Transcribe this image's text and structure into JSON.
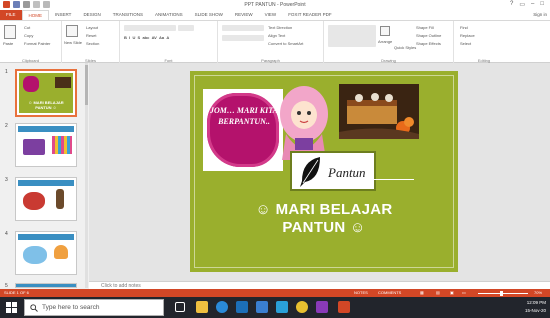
{
  "window": {
    "title": "PPT PANTUN - PowerPoint",
    "help": "?",
    "signin": "Sign in"
  },
  "tabs": [
    "FILE",
    "HOME",
    "INSERT",
    "DESIGN",
    "TRANSITIONS",
    "ANIMATIONS",
    "SLIDE SHOW",
    "REVIEW",
    "VIEW",
    "FOXIT READER PDF"
  ],
  "ribbon": {
    "clipboard": {
      "paste": "Paste",
      "cut": "Cut",
      "copy": "Copy",
      "format_painter": "Format Painter",
      "label": "Clipboard"
    },
    "slides": {
      "new_slide": "New Slide",
      "layout": "Layout",
      "reset": "Reset",
      "section": "Section",
      "label": "Slides"
    },
    "font": {
      "label": "Font"
    },
    "paragraph": {
      "text_direction": "Text Direction",
      "align_text": "Align Text",
      "smartart": "Convert to SmartArt",
      "label": "Paragraph"
    },
    "drawing": {
      "arrange": "Arrange",
      "quick_styles": "Quick Styles",
      "shape_fill": "Shape Fill",
      "shape_outline": "Shape Outline",
      "shape_effects": "Shape Effects",
      "label": "Drawing"
    },
    "editing": {
      "find": "Find",
      "replace": "Replace",
      "select": "Select",
      "label": "Editing"
    }
  },
  "thumbnails": [
    {
      "num": "1",
      "caption": "☺ MARI BELAJAR PANTUN ☺"
    },
    {
      "num": "2"
    },
    {
      "num": "3"
    },
    {
      "num": "4"
    },
    {
      "num": "5"
    }
  ],
  "slide": {
    "cloud_text": "JOM… MARI KITA BERPANTUN..",
    "pantun_label": "Pantun",
    "title_line1": "☺ MARI BELAJAR",
    "title_line2": "PANTUN ☺"
  },
  "notes": {
    "placeholder": "Click to add notes"
  },
  "status": {
    "slide_info": "SLIDE 1 OF 6",
    "notes_btn": "NOTES",
    "comments_btn": "COMMENTS",
    "zoom": "70%"
  },
  "taskbar": {
    "search_placeholder": "Type here to search",
    "time": "12:09 PM",
    "date": "15-Nov-20"
  },
  "colors": {
    "accent": "#d24726",
    "slide_bg": "#9aaf2d",
    "cloud": "#b4126c"
  }
}
